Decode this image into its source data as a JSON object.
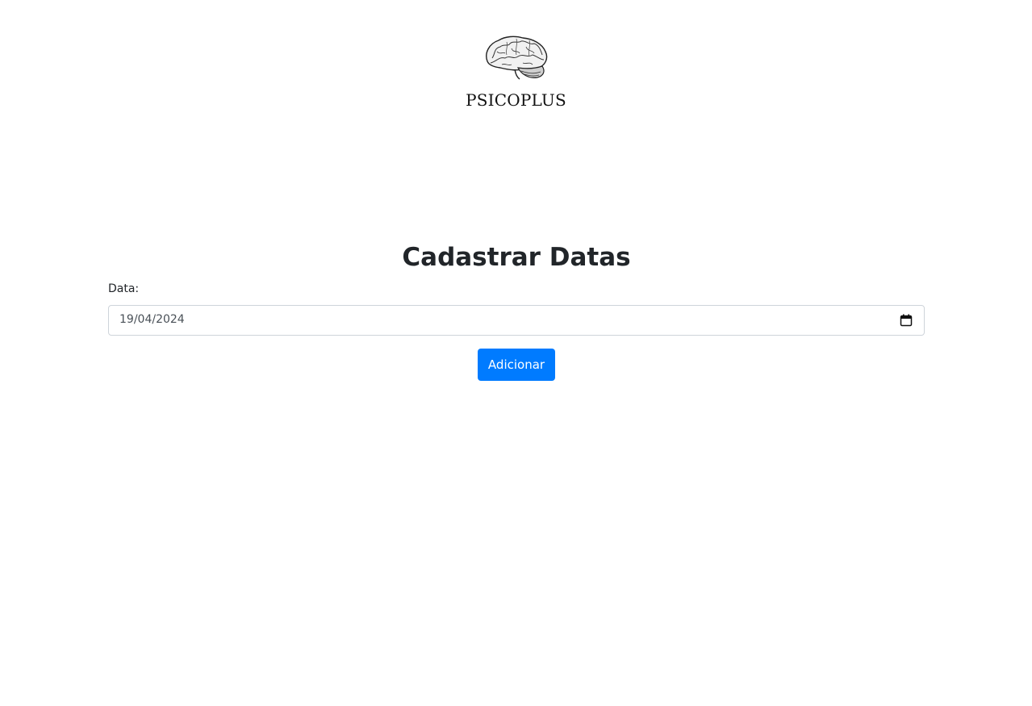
{
  "header": {
    "logo_icon": "brain-icon",
    "brand_name": "PSICOPLUS"
  },
  "main": {
    "title": "Cadastrar Datas",
    "date_field": {
      "label": "Data:",
      "value": "19/04/2024",
      "icon": "calendar-icon"
    },
    "add_button_label": "Adicionar"
  },
  "colors": {
    "primary_button": "#007bff",
    "text": "#212529",
    "input_border": "#ced4da"
  }
}
